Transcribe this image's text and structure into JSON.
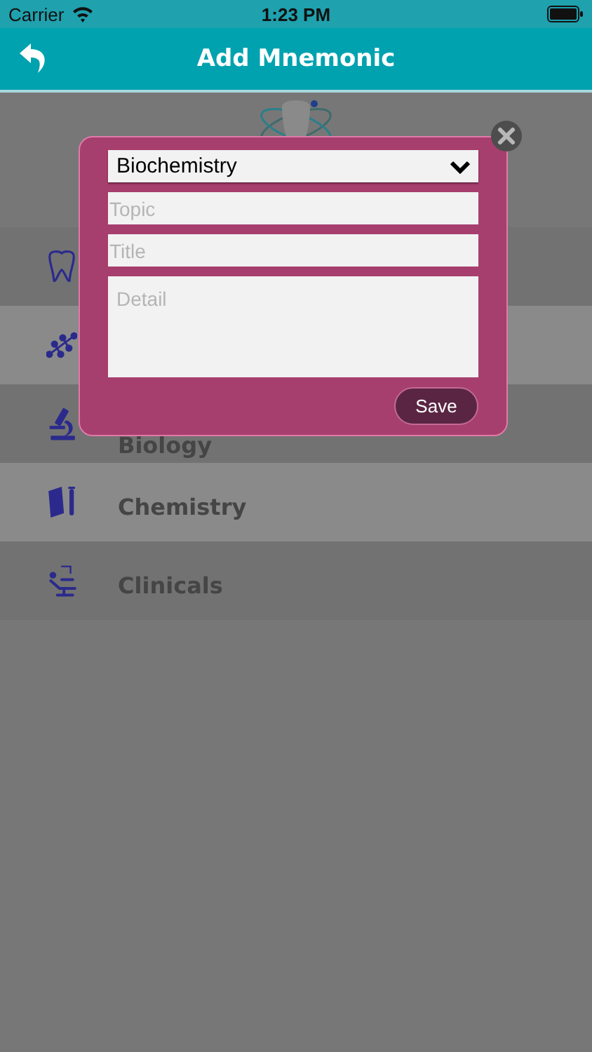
{
  "status_bar": {
    "carrier": "Carrier",
    "time": "1:23 PM"
  },
  "nav": {
    "title": "Add Mnemonic"
  },
  "categories": [
    {
      "shaded": false
    },
    {
      "shaded": true
    },
    {
      "shaded": false,
      "label": "Biology"
    },
    {
      "shaded": true,
      "label": "Chemistry"
    },
    {
      "shaded": false,
      "label": "Clinicals"
    }
  ],
  "dialog": {
    "category": "Biochemistry",
    "topic": {
      "placeholder": "Topic"
    },
    "title": {
      "placeholder": "Title"
    },
    "detail": {
      "placeholder": "Detail"
    },
    "save": "Save"
  }
}
